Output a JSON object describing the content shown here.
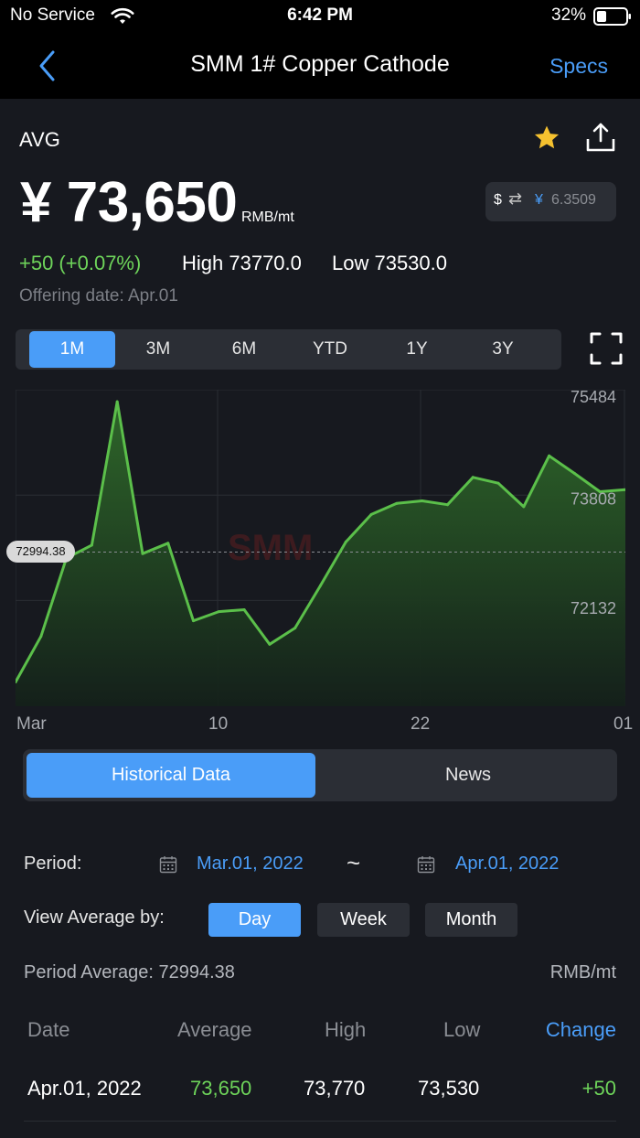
{
  "status": {
    "carrier": "No Service",
    "time": "6:42 PM",
    "battery": "32%"
  },
  "nav": {
    "title": "SMM 1# Copper Cathode",
    "specs_label": "Specs"
  },
  "quote": {
    "avg_label": "AVG",
    "price": "¥ 73,650",
    "unit": "RMB/mt",
    "fx_dollar": "$",
    "fx_yen": "¥",
    "fx_rate": "6.3509",
    "change": "+50 (+0.07%)",
    "high": "High 73770.0",
    "low": "Low 73530.0",
    "offering_date": "Offering date: Apr.01"
  },
  "range_tabs": [
    "1M",
    "3M",
    "6M",
    "YTD",
    "1Y",
    "3Y"
  ],
  "chart_data": {
    "type": "area",
    "y_ticks": [
      "75484",
      "73808",
      "72132"
    ],
    "x_ticks": [
      "Mar",
      "10",
      "22",
      "01"
    ],
    "ref_value": "72994.38",
    "ylim": [
      70630,
      75484
    ],
    "values": [
      71000,
      71700,
      72900,
      73100,
      75300,
      72970,
      73130,
      71940,
      72080,
      72110,
      71580,
      71830,
      72480,
      73150,
      73570,
      73740,
      73780,
      73720,
      74140,
      74050,
      73690,
      74470,
      74200,
      73920,
      73950
    ],
    "colors": {
      "line": "#5bbf4a",
      "ref": "#8a8d93"
    }
  },
  "segments": {
    "historical": "Historical Data",
    "news": "News"
  },
  "period": {
    "label": "Period:",
    "start": "Mar.01, 2022",
    "tilde": "~",
    "end": "Apr.01, 2022"
  },
  "view_avg": {
    "label": "View Average by:",
    "day": "Day",
    "week": "Week",
    "month": "Month"
  },
  "period_avg": {
    "label": "Period Average: 72994.38",
    "unit": "RMB/mt"
  },
  "table": {
    "headers": {
      "date": "Date",
      "average": "Average",
      "high": "High",
      "low": "Low",
      "change": "Change"
    },
    "rows": [
      {
        "date": "Apr.01, 2022",
        "average": "73,650",
        "high": "73,770",
        "low": "73,530",
        "change": "+50"
      }
    ]
  }
}
